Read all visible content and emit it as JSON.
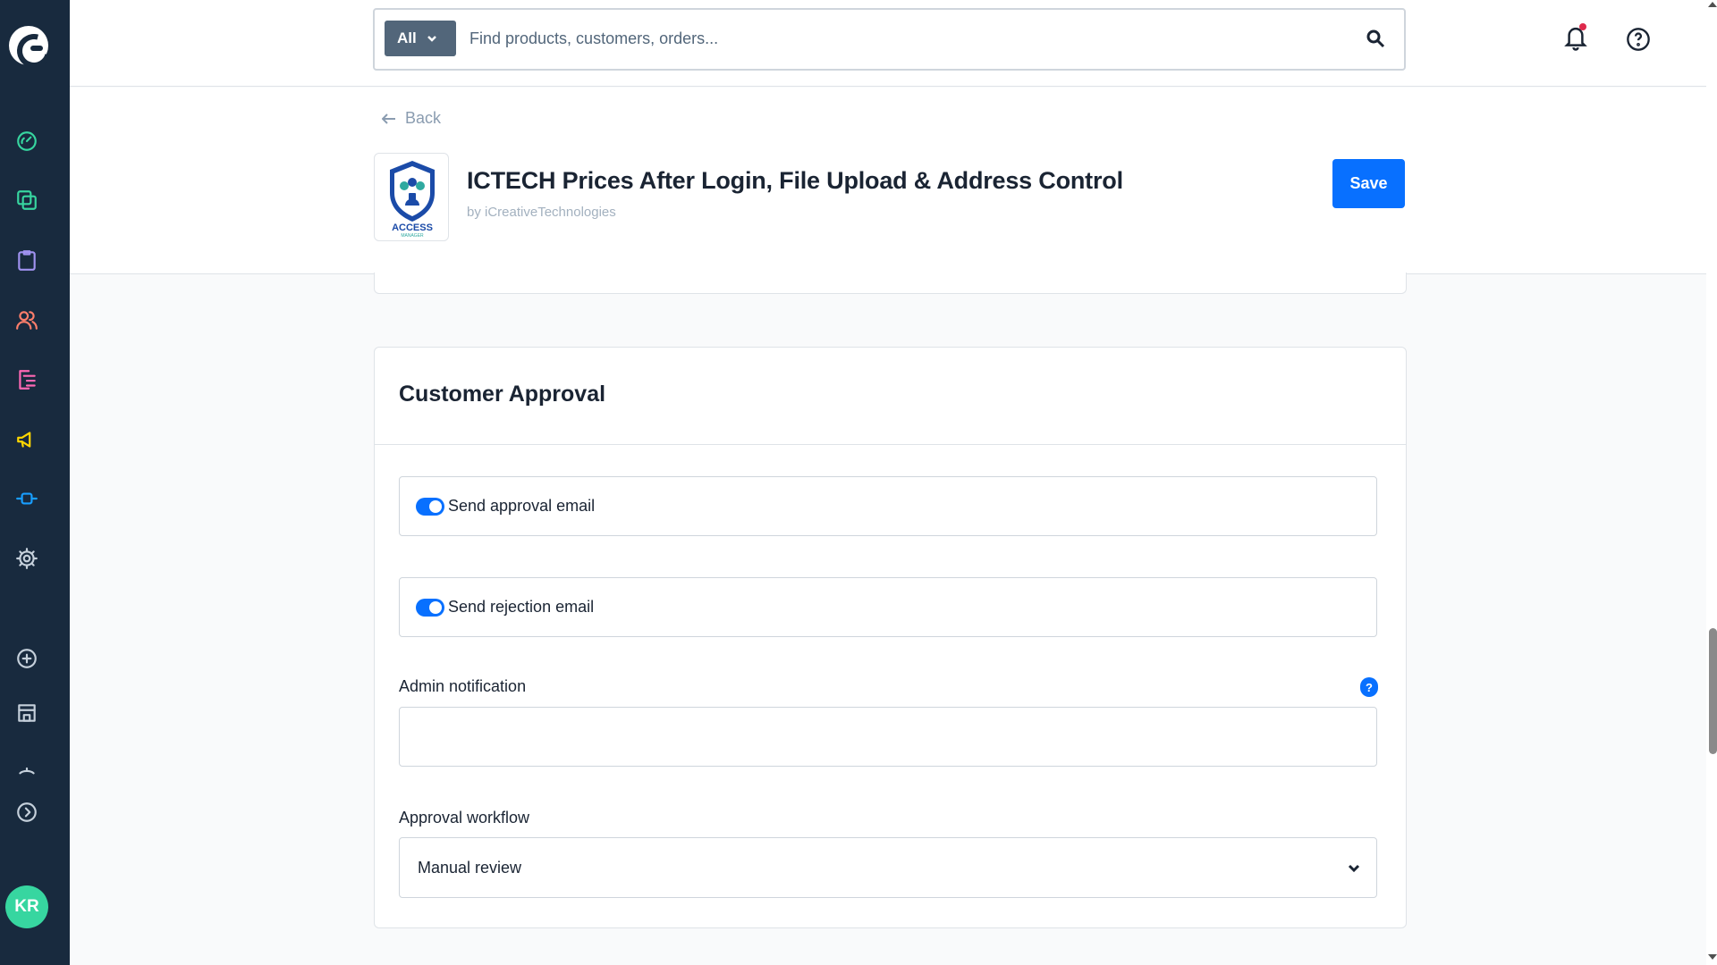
{
  "search": {
    "scope": "All",
    "placeholder": "Find products, customers, orders..."
  },
  "header": {
    "back_label": "Back",
    "app_title": "ICTECH Prices After Login, File Upload & Address Control",
    "by_prefix": "by",
    "vendor": "iCreativeTechnologies",
    "save_label": "Save",
    "logo_text": "ACCESS MANAGER"
  },
  "sidebar": {
    "items": [
      {
        "icon": "dashboard-icon",
        "color": "#37d6a0"
      },
      {
        "icon": "catalogues-icon",
        "color": "#37d6a0"
      },
      {
        "icon": "orders-icon",
        "color": "#a092f0"
      },
      {
        "icon": "customers-icon",
        "color": "#ff7e6b"
      },
      {
        "icon": "content-icon",
        "color": "#ff68b4"
      },
      {
        "icon": "marketing-icon",
        "color": "#ffd700"
      },
      {
        "icon": "extensions-icon",
        "color": "#189eff"
      },
      {
        "icon": "settings-icon",
        "color": "#c5d0db"
      }
    ],
    "user_initials": "KR"
  },
  "card": {
    "title": "Customer Approval",
    "toggles": [
      {
        "label": "Send approval email",
        "on": true
      },
      {
        "label": "Send rejection email",
        "on": true
      }
    ],
    "admin_notification": {
      "label": "Admin notification",
      "value": "",
      "help": "?"
    },
    "approval_workflow": {
      "label": "Approval workflow",
      "value": "Manual review"
    }
  },
  "colors": {
    "sidebar_bg": "#182a3e",
    "primary": "#0870ff",
    "avatar": "#37d6a0"
  }
}
